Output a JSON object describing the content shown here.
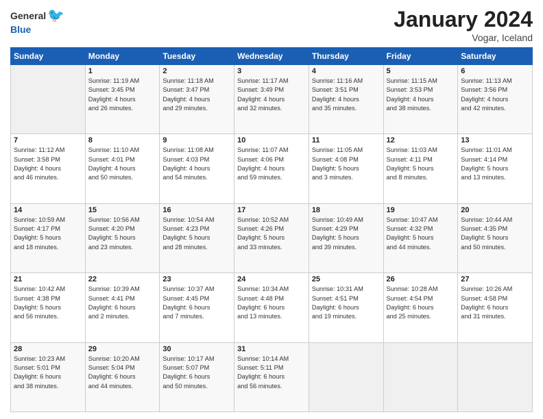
{
  "header": {
    "logo_general": "General",
    "logo_blue": "Blue",
    "main_title": "January 2024",
    "subtitle": "Vogar, Iceland"
  },
  "days_of_week": [
    "Sunday",
    "Monday",
    "Tuesday",
    "Wednesday",
    "Thursday",
    "Friday",
    "Saturday"
  ],
  "weeks": [
    [
      {
        "day": "",
        "content": ""
      },
      {
        "day": "1",
        "content": "Sunrise: 11:19 AM\nSunset: 3:45 PM\nDaylight: 4 hours\nand 26 minutes."
      },
      {
        "day": "2",
        "content": "Sunrise: 11:18 AM\nSunset: 3:47 PM\nDaylight: 4 hours\nand 29 minutes."
      },
      {
        "day": "3",
        "content": "Sunrise: 11:17 AM\nSunset: 3:49 PM\nDaylight: 4 hours\nand 32 minutes."
      },
      {
        "day": "4",
        "content": "Sunrise: 11:16 AM\nSunset: 3:51 PM\nDaylight: 4 hours\nand 35 minutes."
      },
      {
        "day": "5",
        "content": "Sunrise: 11:15 AM\nSunset: 3:53 PM\nDaylight: 4 hours\nand 38 minutes."
      },
      {
        "day": "6",
        "content": "Sunrise: 11:13 AM\nSunset: 3:56 PM\nDaylight: 4 hours\nand 42 minutes."
      }
    ],
    [
      {
        "day": "7",
        "content": "Sunrise: 11:12 AM\nSunset: 3:58 PM\nDaylight: 4 hours\nand 46 minutes."
      },
      {
        "day": "8",
        "content": "Sunrise: 11:10 AM\nSunset: 4:01 PM\nDaylight: 4 hours\nand 50 minutes."
      },
      {
        "day": "9",
        "content": "Sunrise: 11:08 AM\nSunset: 4:03 PM\nDaylight: 4 hours\nand 54 minutes."
      },
      {
        "day": "10",
        "content": "Sunrise: 11:07 AM\nSunset: 4:06 PM\nDaylight: 4 hours\nand 59 minutes."
      },
      {
        "day": "11",
        "content": "Sunrise: 11:05 AM\nSunset: 4:08 PM\nDaylight: 5 hours\nand 3 minutes."
      },
      {
        "day": "12",
        "content": "Sunrise: 11:03 AM\nSunset: 4:11 PM\nDaylight: 5 hours\nand 8 minutes."
      },
      {
        "day": "13",
        "content": "Sunrise: 11:01 AM\nSunset: 4:14 PM\nDaylight: 5 hours\nand 13 minutes."
      }
    ],
    [
      {
        "day": "14",
        "content": "Sunrise: 10:59 AM\nSunset: 4:17 PM\nDaylight: 5 hours\nand 18 minutes."
      },
      {
        "day": "15",
        "content": "Sunrise: 10:56 AM\nSunset: 4:20 PM\nDaylight: 5 hours\nand 23 minutes."
      },
      {
        "day": "16",
        "content": "Sunrise: 10:54 AM\nSunset: 4:23 PM\nDaylight: 5 hours\nand 28 minutes."
      },
      {
        "day": "17",
        "content": "Sunrise: 10:52 AM\nSunset: 4:26 PM\nDaylight: 5 hours\nand 33 minutes."
      },
      {
        "day": "18",
        "content": "Sunrise: 10:49 AM\nSunset: 4:29 PM\nDaylight: 5 hours\nand 39 minutes."
      },
      {
        "day": "19",
        "content": "Sunrise: 10:47 AM\nSunset: 4:32 PM\nDaylight: 5 hours\nand 44 minutes."
      },
      {
        "day": "20",
        "content": "Sunrise: 10:44 AM\nSunset: 4:35 PM\nDaylight: 5 hours\nand 50 minutes."
      }
    ],
    [
      {
        "day": "21",
        "content": "Sunrise: 10:42 AM\nSunset: 4:38 PM\nDaylight: 5 hours\nand 56 minutes."
      },
      {
        "day": "22",
        "content": "Sunrise: 10:39 AM\nSunset: 4:41 PM\nDaylight: 6 hours\nand 2 minutes."
      },
      {
        "day": "23",
        "content": "Sunrise: 10:37 AM\nSunset: 4:45 PM\nDaylight: 6 hours\nand 7 minutes."
      },
      {
        "day": "24",
        "content": "Sunrise: 10:34 AM\nSunset: 4:48 PM\nDaylight: 6 hours\nand 13 minutes."
      },
      {
        "day": "25",
        "content": "Sunrise: 10:31 AM\nSunset: 4:51 PM\nDaylight: 6 hours\nand 19 minutes."
      },
      {
        "day": "26",
        "content": "Sunrise: 10:28 AM\nSunset: 4:54 PM\nDaylight: 6 hours\nand 25 minutes."
      },
      {
        "day": "27",
        "content": "Sunrise: 10:26 AM\nSunset: 4:58 PM\nDaylight: 6 hours\nand 31 minutes."
      }
    ],
    [
      {
        "day": "28",
        "content": "Sunrise: 10:23 AM\nSunset: 5:01 PM\nDaylight: 6 hours\nand 38 minutes."
      },
      {
        "day": "29",
        "content": "Sunrise: 10:20 AM\nSunset: 5:04 PM\nDaylight: 6 hours\nand 44 minutes."
      },
      {
        "day": "30",
        "content": "Sunrise: 10:17 AM\nSunset: 5:07 PM\nDaylight: 6 hours\nand 50 minutes."
      },
      {
        "day": "31",
        "content": "Sunrise: 10:14 AM\nSunset: 5:11 PM\nDaylight: 6 hours\nand 56 minutes."
      },
      {
        "day": "",
        "content": ""
      },
      {
        "day": "",
        "content": ""
      },
      {
        "day": "",
        "content": ""
      }
    ]
  ]
}
